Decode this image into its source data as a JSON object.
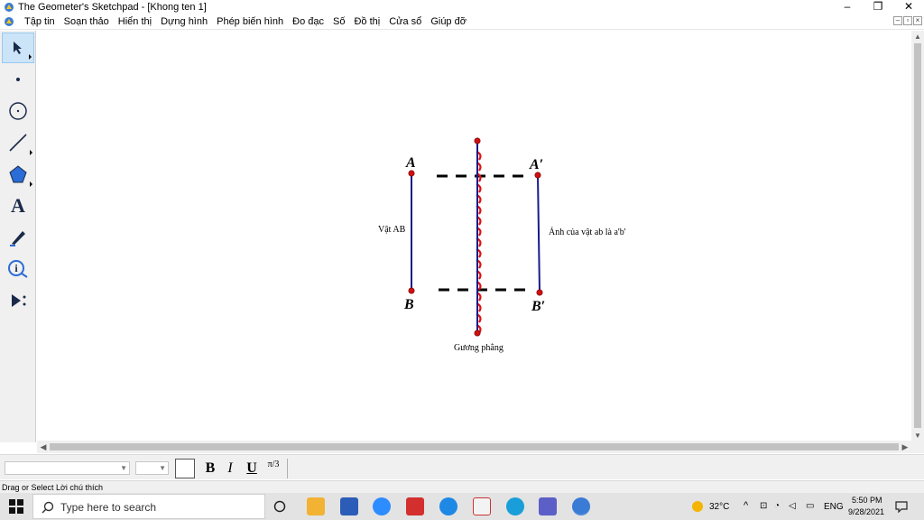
{
  "window": {
    "title": "The Geometer's Sketchpad - [Khong ten 1]",
    "minimize": "–",
    "restore": "❐",
    "close": "✕"
  },
  "menu": {
    "items": [
      "Tập tin",
      "Soạn thảo",
      "Hiển thị",
      "Dựng hình",
      "Phép biến hình",
      "Đo đạc",
      "Số",
      "Đồ thị",
      "Cửa sổ",
      "Giúp đỡ"
    ]
  },
  "tools": [
    {
      "name": "selection-arrow-tool",
      "icon": "arrow-cursor-icon",
      "selected": true
    },
    {
      "name": "point-tool",
      "icon": "point-icon"
    },
    {
      "name": "compass-tool",
      "icon": "circle-icon"
    },
    {
      "name": "straightedge-tool",
      "icon": "segment-icon"
    },
    {
      "name": "polygon-tool",
      "icon": "pentagon-icon"
    },
    {
      "name": "text-tool",
      "icon": "letter-a-icon",
      "glyph": "A"
    },
    {
      "name": "marker-tool",
      "icon": "pen-icon"
    },
    {
      "name": "information-tool",
      "icon": "info-icon",
      "glyph": "i"
    },
    {
      "name": "custom-tool",
      "icon": "play-more-icon"
    }
  ],
  "sketch": {
    "labels": {
      "A": "A",
      "B": "B",
      "A_prime": "A′",
      "B_prime": "B′",
      "object": "Vật AB",
      "image": "Ảnh của vật ab là a'b'",
      "mirror": "Gương phẳng"
    },
    "colors": {
      "segment": "#1a1a8c",
      "point": "#cc1111",
      "hatch": "#e01010",
      "dash": "#000000"
    }
  },
  "formatbar": {
    "bold": "B",
    "italic": "I",
    "underline": "U",
    "math": "π/3"
  },
  "status": {
    "text": "Drag or Select Lời chú thích"
  },
  "taskbar": {
    "search_placeholder": "Type here to search",
    "temperature": "32°C",
    "language": "ENG",
    "time": "5:50 PM",
    "date": "9/28/2021"
  }
}
